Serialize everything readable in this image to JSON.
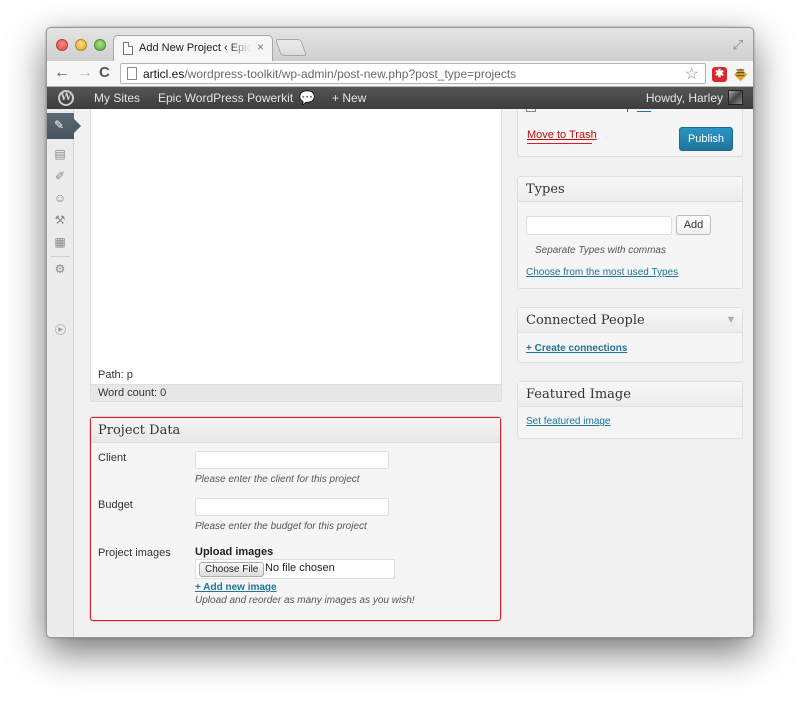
{
  "browser": {
    "tab_title": "Add New Project ‹ Epic WordPress Powerkit",
    "tab_close": "×",
    "url_domain": "articl.es",
    "url_path": "/wordpress-toolkit/wp-admin/post-new.php?post_type=projects",
    "back_glyph": "←",
    "forward_glyph": "→",
    "reload_glyph": "C",
    "star_glyph": "☆",
    "menu_glyph": "≡",
    "ext_glyph": "✱"
  },
  "adminbar": {
    "logo": "W",
    "my_sites": "My Sites",
    "site_name": "Epic WordPress Powerkit",
    "new_label": "+ New",
    "howdy": "Howdy, Harley"
  },
  "editor": {
    "path": "Path: p",
    "word_count": "Word count: 0"
  },
  "project_data": {
    "title": "Project Data",
    "client_label": "Client",
    "client_value": "",
    "client_desc": "Please enter the client for this project",
    "budget_label": "Budget",
    "budget_value": "",
    "budget_desc": "Please enter the budget for this project",
    "images_label": "Project images",
    "upload_title": "Upload images",
    "choose_file": "Choose File",
    "file_status": "No file chosen",
    "add_image": "+ Add new image",
    "upload_desc": "Upload and reorder as many images as you wish!"
  },
  "publish": {
    "trash": "Move to Trash",
    "publish_button": "Publish"
  },
  "types": {
    "title": "Types",
    "input_value": "",
    "add_button": "Add",
    "hint": "Separate Types with commas",
    "choose_link": "Choose from the most used Types"
  },
  "connected_people": {
    "title": "Connected People",
    "create_link": "+ Create connections"
  },
  "featured_image": {
    "title": "Featured Image",
    "set_link": "Set featured image"
  },
  "colors": {
    "accent": "#21759b",
    "highlight_border": "#d4202c",
    "trash": "#bc0b0b"
  }
}
